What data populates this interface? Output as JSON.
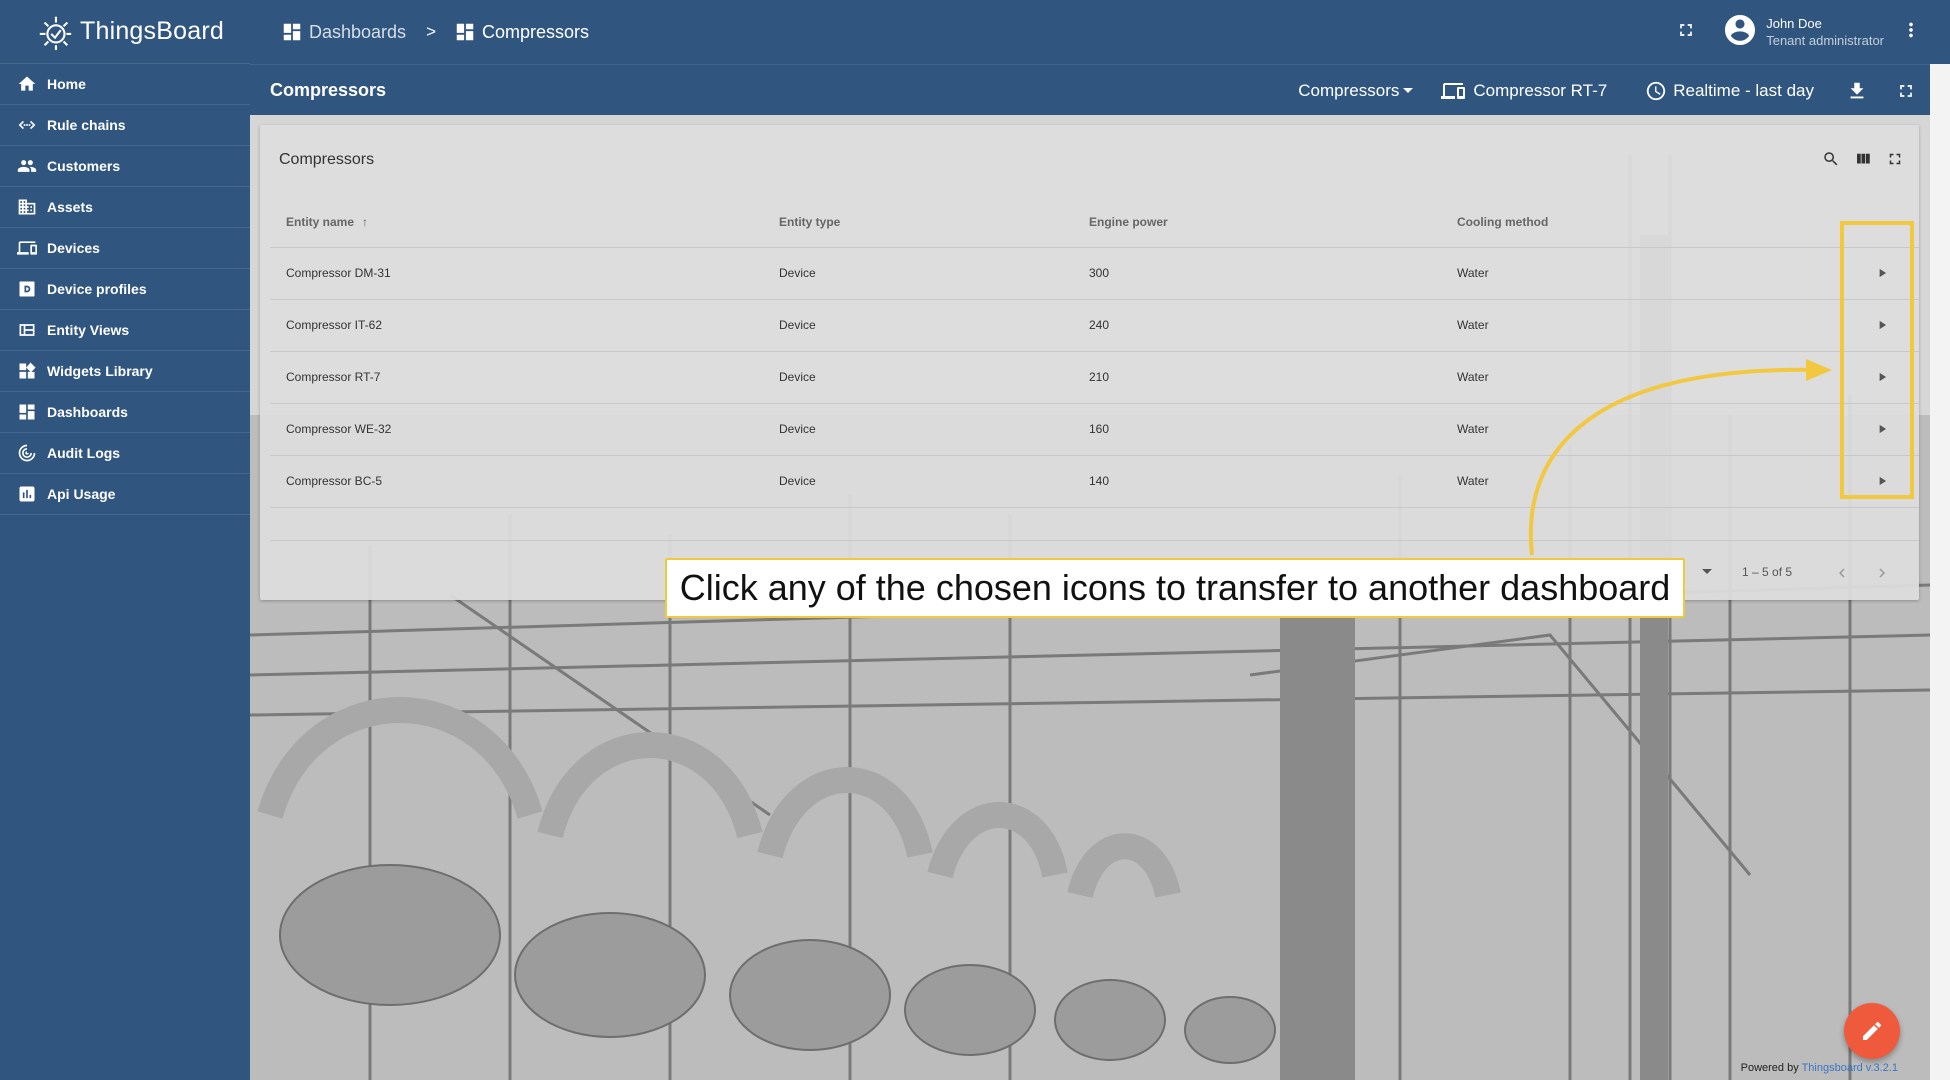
{
  "app": {
    "name": "ThingsBoard"
  },
  "sidebar": {
    "items": [
      {
        "label": "Home",
        "icon": "home-icon"
      },
      {
        "label": "Rule chains",
        "icon": "rule-chains-icon"
      },
      {
        "label": "Customers",
        "icon": "customers-icon"
      },
      {
        "label": "Assets",
        "icon": "assets-icon"
      },
      {
        "label": "Devices",
        "icon": "devices-icon"
      },
      {
        "label": "Device profiles",
        "icon": "device-profiles-icon"
      },
      {
        "label": "Entity Views",
        "icon": "entity-views-icon"
      },
      {
        "label": "Widgets Library",
        "icon": "widgets-library-icon"
      },
      {
        "label": "Dashboards",
        "icon": "dashboards-icon"
      },
      {
        "label": "Audit Logs",
        "icon": "audit-logs-icon"
      },
      {
        "label": "Api Usage",
        "icon": "api-usage-icon"
      }
    ]
  },
  "header": {
    "breadcrumb": [
      {
        "label": "Dashboards"
      },
      {
        "label": "Compressors"
      }
    ],
    "separator": ">",
    "user": {
      "name": "John Doe",
      "role": "Tenant administrator"
    }
  },
  "dashboard": {
    "title": "Compressors",
    "state_selector": "Compressors",
    "entity": "Compressor RT-7",
    "timewindow": "Realtime - last day"
  },
  "widget": {
    "title": "Compressors",
    "columns": [
      "Entity name",
      "Entity type",
      "Engine power",
      "Cooling method"
    ],
    "rows": [
      [
        "Compressor DM-31",
        "Device",
        "300",
        "Water"
      ],
      [
        "Compressor IT-62",
        "Device",
        "240",
        "Water"
      ],
      [
        "Compressor RT-7",
        "Device",
        "210",
        "Water"
      ],
      [
        "Compressor WE-32",
        "Device",
        "160",
        "Water"
      ],
      [
        "Compressor BC-5",
        "Device",
        "140",
        "Water"
      ]
    ],
    "pagination": "1 – 5 of 5"
  },
  "annotation": {
    "callout": "Click any of the chosen icons to transfer to another dashboard",
    "color": "#f2c840"
  },
  "footer": {
    "powered_prefix": "Powered by",
    "powered_link": "Thingsboard v.3.2.1"
  },
  "colors": {
    "primary": "#305680",
    "fab": "#f05a3c",
    "accent": "#f2c840"
  }
}
